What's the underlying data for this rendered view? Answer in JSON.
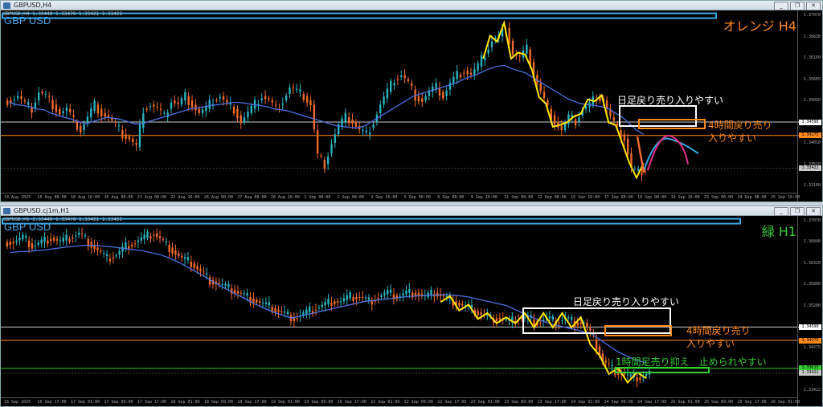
{
  "colors": {
    "bull": "#2bb3c0",
    "bear": "#f06a2a",
    "zigzag": "#ffe600",
    "ma": "#4d6fe0",
    "white": "#ffffff",
    "orange": "#ff8a1e",
    "green": "#33cc33",
    "cyan": "#39a9e8",
    "pink": "#e8308a",
    "pair": "#4aa8e8"
  },
  "windows": [
    {
      "id": "h4",
      "title": "GBPUSD,H4",
      "ohlc": "GBPUSD,H4  1.33448 1.33478 1.33421 1.33422",
      "pair_label": "GBP USD",
      "tf_label": "オレンジ H4",
      "price_labels": [
        "1.37070",
        "1.36630",
        "1.36160",
        "1.35605",
        "1.35050",
        "1.34590",
        "1.34010",
        "1.33510",
        "1.33160"
      ],
      "current_prices": {
        "white": "1.34590",
        "orange": "1.34275",
        "price": "1.33422"
      },
      "time_labels": [
        "14 Aug 2025",
        "15 Aug 08:00",
        "18 Aug 16:00",
        "20 Aug 00:00",
        "21 Aug 08:00",
        "22 Aug 16:00",
        "26 Aug 00:00",
        "27 Aug 08:00",
        "28 Aug 16:00",
        "1 Sep 00:00",
        "2 Sep 08:00",
        "3 Sep 16:00",
        "5 Sep 00:00",
        "8 Sep 08:00",
        "9 Sep 16:00",
        "11 Sep 00:00",
        "12 Sep 08:00",
        "15 Sep 16:00",
        "17 Sep 00:00",
        "18 Sep 08:00",
        "19 Sep 16:00",
        "23 Sep 00:00",
        "24 Sep 08:00",
        "25 Sep 16:00"
      ],
      "notes": {
        "daily": "日足戻り売り入りやすい",
        "h4_line1": "4時間戻り売り",
        "h4_line2": "入りやすい"
      }
    },
    {
      "id": "h1",
      "title": "GBPUSD.cj1m,H1",
      "ohlc": "GBPUSD,H1  1.33448 1.33478 1.33421 1.33422",
      "pair_label": "GBP USD",
      "tf_label": "緑 H1",
      "price_labels": [
        "1.37070",
        "1.36840",
        "1.36320",
        "1.35800",
        "1.35280",
        "1.34590",
        "1.34275",
        "1.33800",
        "1.33422"
      ],
      "current_prices": {
        "white": "1.34590",
        "orange": "1.34275",
        "green": "1.33615",
        "price": "1.33422"
      },
      "time_labels": [
        "16 Sep 2025",
        "16 Sep 17:00",
        "17 Sep 01:00",
        "17 Sep 09:00",
        "17 Sep 17:00",
        "18 Sep 01:00",
        "18 Sep 09:00",
        "18 Sep 17:00",
        "19 Sep 01:00",
        "19 Sep 09:00",
        "19 Sep 17:00",
        "22 Sep 01:00",
        "22 Sep 09:00",
        "22 Sep 17:00",
        "23 Sep 01:00",
        "23 Sep 09:00",
        "23 Sep 17:00",
        "24 Sep 01:00",
        "24 Sep 09:00",
        "24 Sep 17:00",
        "25 Sep 01:00",
        "25 Sep 09:00",
        "25 Sep 17:00",
        "26 Sep 01:00"
      ],
      "notes": {
        "daily": "日足戻り売り入りやすい",
        "h4_line1": "4時間戻り売り",
        "h4_line2": "入りやすい",
        "h1": "1時間足売り抑え　止められやすい"
      }
    }
  ],
  "chart_data": [
    {
      "type": "candlestick",
      "title": "GBPUSD,H4",
      "ylim": [
        1.331,
        1.371
      ],
      "levels": {
        "daily_resistance": 1.3459,
        "h4_resistance": 1.34275,
        "top_line": 1.3707
      },
      "close_path": [
        1.351,
        1.352,
        1.35,
        1.349,
        1.353,
        1.352,
        1.35,
        1.348,
        1.349,
        1.346,
        1.344,
        1.347,
        1.35,
        1.348,
        1.347,
        1.345,
        1.343,
        1.342,
        1.34,
        1.349,
        1.35,
        1.349,
        1.347,
        1.351,
        1.35,
        1.352,
        1.35,
        1.348,
        1.349,
        1.351,
        1.352,
        1.35,
        1.349,
        1.346,
        1.348,
        1.35,
        1.352,
        1.351,
        1.349,
        1.351,
        1.354,
        1.353,
        1.352,
        1.35,
        1.338,
        1.336,
        1.341,
        1.345,
        1.347,
        1.346,
        1.344,
        1.343,
        1.346,
        1.35,
        1.353,
        1.356,
        1.357,
        1.355,
        1.352,
        1.351,
        1.353,
        1.354,
        1.352,
        1.355,
        1.357,
        1.358,
        1.357,
        1.359,
        1.362,
        1.365,
        1.366,
        1.368,
        1.362,
        1.361,
        1.363,
        1.357,
        1.353,
        1.349,
        1.346,
        1.344,
        1.347,
        1.346,
        1.349,
        1.35,
        1.352,
        1.351,
        1.347,
        1.344,
        1.342,
        1.335,
        1.334,
        1.335
      ],
      "ma_path": [
        1.3505,
        1.35,
        1.3498,
        1.3495,
        1.349,
        1.3488,
        1.348,
        1.3475,
        1.347,
        1.3465,
        1.346,
        1.3455,
        1.346,
        1.3465,
        1.347,
        1.3468,
        1.3465,
        1.346,
        1.3455,
        1.3455,
        1.346,
        1.3465,
        1.347,
        1.3475,
        1.348,
        1.3485,
        1.349,
        1.3492,
        1.3495,
        1.3498,
        1.35,
        1.3502,
        1.3505,
        1.3505,
        1.3503,
        1.35,
        1.3498,
        1.3495,
        1.349,
        1.3488,
        1.3485,
        1.348,
        1.3475,
        1.347,
        1.3465,
        1.346,
        1.3455,
        1.345,
        1.3448,
        1.3446,
        1.3445,
        1.345,
        1.346,
        1.347,
        1.348,
        1.349,
        1.35,
        1.351,
        1.352,
        1.3525,
        1.353,
        1.3535,
        1.354,
        1.3545,
        1.355,
        1.3558,
        1.3565,
        1.357,
        1.3578,
        1.3585,
        1.359,
        1.3592,
        1.3585,
        1.358,
        1.3575,
        1.3565,
        1.3555,
        1.3545,
        1.3535,
        1.3525,
        1.3515,
        1.3508,
        1.3502,
        1.35,
        1.3498,
        1.3495,
        1.349,
        1.348,
        1.347,
        1.3455,
        1.344,
        1.343
      ]
    },
    {
      "type": "candlestick",
      "title": "GBPUSD,H1",
      "ylim": [
        1.331,
        1.371
      ],
      "levels": {
        "daily_resistance": 1.3459,
        "h4_resistance": 1.34275,
        "h1_support": 1.33615,
        "top_line": 1.3707
      },
      "close_path": [
        1.366,
        1.367,
        1.365,
        1.366,
        1.367,
        1.366,
        1.367,
        1.368,
        1.366,
        1.364,
        1.362,
        1.363,
        1.365,
        1.366,
        1.367,
        1.368,
        1.366,
        1.364,
        1.362,
        1.361,
        1.359,
        1.357,
        1.356,
        1.355,
        1.354,
        1.353,
        1.352,
        1.351,
        1.35,
        1.349,
        1.348,
        1.349,
        1.35,
        1.351,
        1.352,
        1.352,
        1.353,
        1.353,
        1.352,
        1.353,
        1.354,
        1.353,
        1.354,
        1.354,
        1.353,
        1.354,
        1.353,
        1.352,
        1.351,
        1.35,
        1.349,
        1.348,
        1.348,
        1.347,
        1.348,
        1.348,
        1.347,
        1.348,
        1.347,
        1.348,
        1.347,
        1.347,
        1.343,
        1.338,
        1.336,
        1.335,
        1.334,
        1.334,
        1.335
      ],
      "ma_path": [
        1.3635,
        1.3637,
        1.3638,
        1.364,
        1.3642,
        1.3645,
        1.3648,
        1.365,
        1.3652,
        1.3652,
        1.365,
        1.3648,
        1.3645,
        1.3642,
        1.364,
        1.3635,
        1.363,
        1.3622,
        1.3612,
        1.36,
        1.3588,
        1.3575,
        1.3562,
        1.355,
        1.3538,
        1.3527,
        1.3515,
        1.3505,
        1.3495,
        1.3488,
        1.348,
        1.3485,
        1.349,
        1.3495,
        1.35,
        1.3505,
        1.351,
        1.3515,
        1.352,
        1.3522,
        1.3525,
        1.3527,
        1.353,
        1.3532,
        1.3533,
        1.3534,
        1.3535,
        1.3535,
        1.3533,
        1.353,
        1.3525,
        1.352,
        1.3515,
        1.351,
        1.35,
        1.349,
        1.348,
        1.3472,
        1.3465,
        1.346,
        1.3455,
        1.345,
        1.3445,
        1.343,
        1.3415,
        1.34,
        1.339,
        1.338,
        1.3375
      ]
    }
  ]
}
